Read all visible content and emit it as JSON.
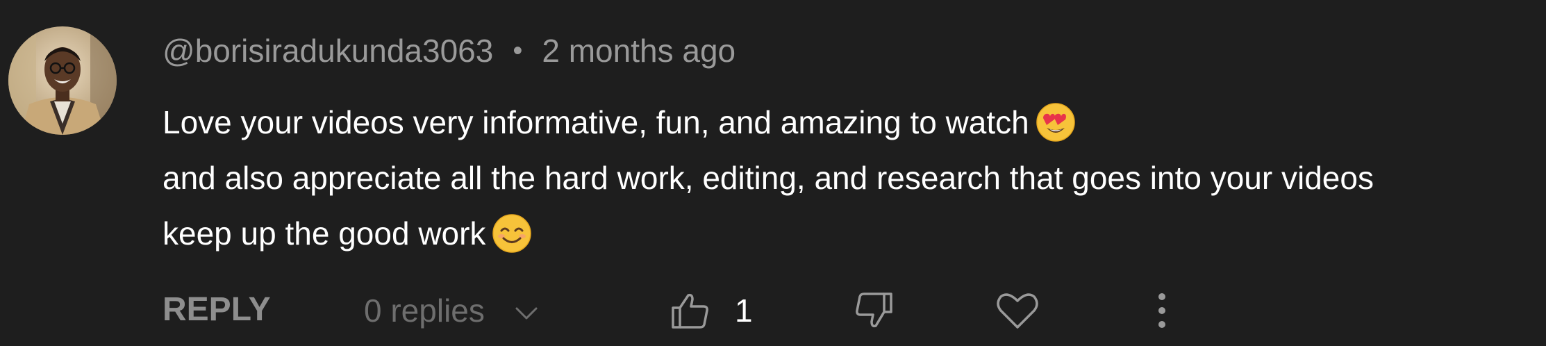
{
  "comment": {
    "author": "@borisiradukunda3063",
    "separator": "•",
    "time": "2 months ago",
    "lines": [
      "Love your videos very informative, fun, and amazing to watch",
      "and also appreciate all the hard work, editing, and research that goes into your videos",
      "keep up the good work"
    ],
    "line_emojis": [
      "heart-eyes-emoji",
      "",
      "smiling-emoji"
    ]
  },
  "actions": {
    "reply_label": "REPLY",
    "replies_label": "0 replies",
    "like_count": "1"
  },
  "icons": {
    "avatar": "avatar",
    "chevron": "chevron-down-icon",
    "like": "thumbs-up-icon",
    "dislike": "thumbs-down-icon",
    "heart": "heart-icon",
    "more": "more-vert-icon"
  },
  "colors": {
    "background": "#1e1e1e",
    "meta_text": "#9a9a9a",
    "body_text": "#ffffff",
    "action_muted": "#8e8e8e",
    "replies_muted": "#6e6e6e"
  }
}
